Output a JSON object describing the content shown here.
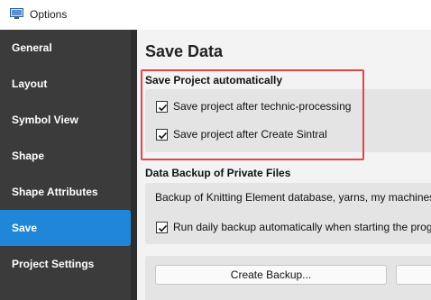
{
  "window": {
    "title": "Options"
  },
  "sidebar": {
    "items": [
      {
        "label": "General",
        "active": false
      },
      {
        "label": "Layout",
        "active": false
      },
      {
        "label": "Symbol View",
        "active": false
      },
      {
        "label": "Shape",
        "active": false
      },
      {
        "label": "Shape Attributes",
        "active": false
      },
      {
        "label": "Save",
        "active": true
      },
      {
        "label": "Project Settings",
        "active": false
      }
    ]
  },
  "main": {
    "title": "Save Data",
    "save_project": {
      "heading": "Save Project automatically",
      "options": [
        {
          "label": "Save project after technic-processing",
          "checked": true
        },
        {
          "label": "Save project after Create Sintral",
          "checked": true
        }
      ]
    },
    "backup": {
      "heading": "Data Backup of Private Files",
      "info": "Backup of Knitting Element database, yarns, my machines",
      "option": {
        "label": "Run daily backup automatically when starting the prog",
        "checked": true
      },
      "create_button": "Create Backup..."
    }
  },
  "colors": {
    "sidebar_bg": "#3b3b3b",
    "active_item": "#1f86d8",
    "highlight_border": "#e0464a"
  }
}
